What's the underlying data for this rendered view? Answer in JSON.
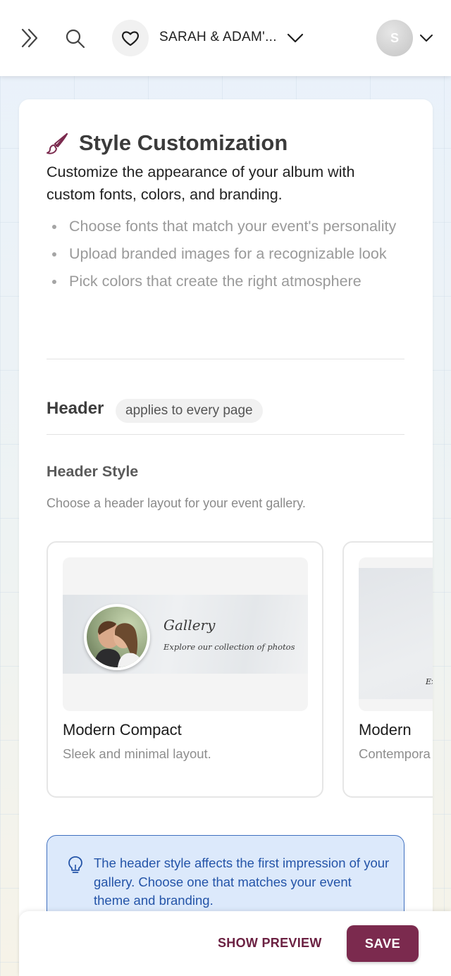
{
  "topbar": {
    "album_name": "SARAH & ADAM'...",
    "avatar_initial": "S"
  },
  "section": {
    "title": "Style Customization",
    "description": "Customize the appearance of your album with custom fonts, colors, and branding.",
    "bullets": [
      "Choose fonts that match your event's personality",
      "Upload branded images for a recognizable look",
      "Pick colors that create the right atmosphere"
    ]
  },
  "header_section": {
    "title": "Header",
    "badge": "applies to every page",
    "style_title": "Header Style",
    "style_desc": "Choose a header layout for your event gallery.",
    "options": [
      {
        "name": "Modern Compact",
        "desc": "Sleek and minimal layout.",
        "preview_title": "Gallery",
        "preview_tagline": "Explore our collection of photos"
      },
      {
        "name": "Modern",
        "desc": "Contempora",
        "preview_tagline": "Ex"
      }
    ]
  },
  "tip": {
    "text": "The header style affects the first impression of your gallery. Choose one that matches your event theme and branding."
  },
  "actions": {
    "preview_label": "SHOW PREVIEW",
    "save_label": "SAVE"
  },
  "colors": {
    "accent": "#7b2a4e",
    "tip_bg": "#dce9fb",
    "tip_text": "#2454a8",
    "tip_border": "#3f6fbf"
  },
  "icons": [
    "expand-icon",
    "search-icon",
    "heart-icon",
    "chevron-down-icon",
    "paintbrush-icon",
    "lightbulb-icon"
  ]
}
